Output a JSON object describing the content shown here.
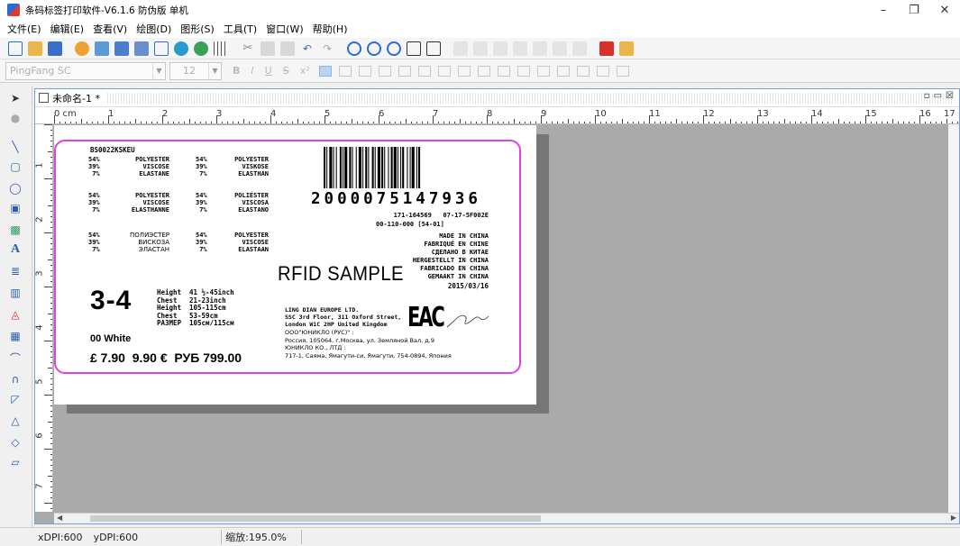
{
  "window": {
    "title": "条码标签打印软件-V6.1.6 防伪版 单机"
  },
  "menu": [
    "文件(E)",
    "编辑(E)",
    "查看(V)",
    "绘图(D)",
    "图形(S)",
    "工具(T)",
    "窗口(W)",
    "帮助(H)"
  ],
  "font_toolbar": {
    "font_name": "PingFang SC",
    "font_size": "12"
  },
  "document": {
    "title": "未命名-1 *"
  },
  "ruler": {
    "h_labels": [
      "0 cm",
      "1",
      "2",
      "3",
      "4",
      "5",
      "6",
      "7",
      "8",
      "9",
      "10",
      "11",
      "12",
      "13",
      "14",
      "15",
      "16",
      "17"
    ],
    "v_labels": [
      "1",
      "2",
      "3",
      "4",
      "5",
      "6",
      "7"
    ]
  },
  "label": {
    "style_code": "BS0022KSKEU",
    "comp_en_pct": "54%\n39%\n 7%",
    "comp_en": "POLYESTER\nVISCOSE\nELASTANE",
    "comp_de_pct": "54%\n39%\n 7%",
    "comp_de": "POLYESTER\nVISKOSE\nELASTHAN",
    "comp_fr_pct": "54%\n39%\n 7%",
    "comp_fr": "POLYESTER\nVISCOSE\nÉLASTHANNE",
    "comp_es_pct": "54%\n39%\n 7%",
    "comp_es": "POLIÉSTER\nVISCOSA\nELASTANO",
    "comp_ru_pct": "54%\n39%\n 7%",
    "comp_ru": "ПОЛИЭСТЕР\nВИСКОЗА\nЭЛАСТАН",
    "comp_nl_pct": "54%\n39%\n 7%",
    "comp_nl": "POLYESTER\nVISCOSE\nELASTAAN",
    "barcode_number": "2000075147936",
    "code_line1": "171-164569   07-17-5F002E",
    "code_line2": "00-110-000 [54-01]",
    "origin": "MADE IN CHINA\nFABRIQUÉ EN CHINE\nСДЕЛАНО В КИТАЕ\nHERGESTELLT IN CHINA\nFABRICADO EN CHINA\nGEMAAKT IN CHINA",
    "date": "2015/03/16",
    "rfid": "RFID SAMPLE",
    "size": "3-4",
    "measure_keys": "Height\nChest\nHeight\nChest\nРАЗМЕР",
    "measure_vals": "41 ½-45inch\n21-23inch\n105-115cm\n53-59cm\n105см/115см",
    "color": "00 White",
    "prices": "£ 7.90  9.90 €  РУБ 799.00",
    "importer": "LING DIAN EUROPE LTD.\nSSC 3rd Floor, 311 Oxford Street,\nLondon W1C 2HP United Kingdom",
    "eac_mark": "EAC",
    "address_ru": "ООО\"ЮНИКЛО (РУС)\" :\nРоссия, 105064, г.Москва, ул. Земляной Вал, д.9\nЮНИКЛО КО., ЛТД :\n717-1, Саяма, Ямагути-си, Ямагути, 754-0894, Япония"
  },
  "status": {
    "xdpi": "xDPI:600",
    "ydpi": "yDPI:600",
    "zoom": "缩放:195.0%"
  }
}
